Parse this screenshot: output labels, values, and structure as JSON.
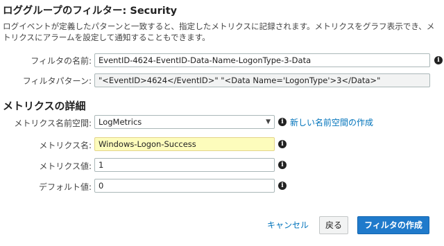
{
  "page": {
    "title": "ロググループのフィルター: Security",
    "description": "ログイベントが定義したパターンと一致すると、指定したメトリクスに記録されます。メトリクスをグラフ表示でき、メトリクスにアラームを設定して通知することもできます。"
  },
  "filter": {
    "name_label": "フィルタの名前:",
    "name_value": "EventID-4624-EventID-Data-Name-LogonType-3-Data",
    "pattern_label": "フィルタパターン:",
    "pattern_value": "\"<EventID>4624</EventID>\" \"<Data Name='LogonType'>3</Data>\""
  },
  "metrics": {
    "section_title": "メトリクスの詳細",
    "namespace_label": "メトリクス名前空間:",
    "namespace_value": "LogMetrics",
    "new_namespace_link": "新しい名前空間の作成",
    "name_label": "メトリクス名:",
    "name_value": "Windows-Logon-Success",
    "value_label": "メトリクス値:",
    "value_value": "1",
    "default_label": "デフォルト値:",
    "default_value": "0"
  },
  "actions": {
    "cancel": "キャンセル",
    "back": "戻る",
    "create": "フィルタの作成"
  },
  "icons": {
    "info": "i",
    "dropdown": "▼"
  },
  "colors": {
    "primary_button": "#1f7acb",
    "link": "#0073bb",
    "highlight_field": "#fdfcbc"
  }
}
